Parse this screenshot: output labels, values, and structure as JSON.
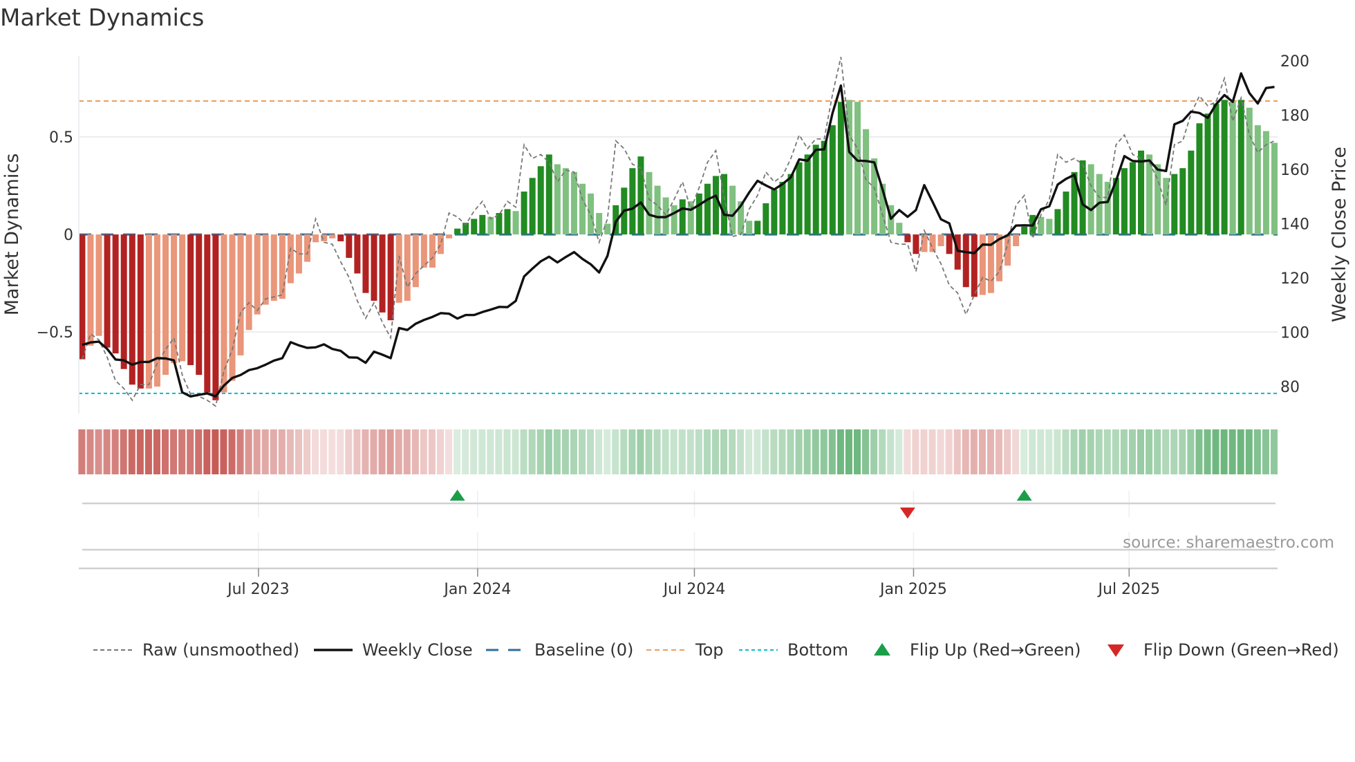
{
  "title": "Market Dynamics",
  "source": "source: sharemaestro.com",
  "colors": {
    "dark_red": "#b22222",
    "light_red": "#e9967a",
    "dark_green": "#228b22",
    "light_green": "#80c080",
    "raw": "#777777",
    "close": "#111111",
    "baseline": "#2c6f9e",
    "top": "#e8a46a",
    "bottom": "#17becf",
    "flip_up": "#1a9e4a",
    "flip_down": "#d62728",
    "strip_red": "#c65a55",
    "strip_green": "#4fa864"
  },
  "legend": [
    {
      "key": "raw",
      "label": "Raw (unsmoothed)"
    },
    {
      "key": "close",
      "label": "Weekly Close"
    },
    {
      "key": "baseline",
      "label": "Baseline (0)"
    },
    {
      "key": "top",
      "label": "Top"
    },
    {
      "key": "bottom",
      "label": "Bottom"
    },
    {
      "key": "flip_up",
      "label": "Flip Up (Red→Green)"
    },
    {
      "key": "flip_down",
      "label": "Flip Down (Green→Red)"
    }
  ],
  "chart_data": {
    "type": "bar",
    "title": "Market Dynamics",
    "ylabel": "Market Dynamics",
    "y2label": "Weekly Close Price",
    "ylim": [
      -0.918,
      0.915
    ],
    "y2lim": [
      70,
      201.8
    ],
    "yticks": [
      {
        "v": 0.5,
        "label": "0.5"
      },
      {
        "v": 0,
        "label": "0"
      },
      {
        "v": -0.5,
        "label": "−0.5"
      }
    ],
    "y2ticks": [
      200,
      180,
      160,
      140,
      120,
      100,
      80
    ],
    "xticks": [
      {
        "date": "2023-07-01",
        "label": "Jul 2023"
      },
      {
        "date": "2024-01-01",
        "label": "Jan 2024"
      },
      {
        "date": "2024-07-01",
        "label": "Jul 2024"
      },
      {
        "date": "2025-01-01",
        "label": "Jan 2025"
      },
      {
        "date": "2025-07-01",
        "label": "Jul 2025"
      }
    ],
    "start_date": "2023-02-03",
    "frequency": "weekly",
    "top_level": 0.684,
    "bottom_level": -0.815,
    "baseline": 0,
    "momentum": [
      -0.64,
      -0.57,
      -0.52,
      -0.58,
      -0.61,
      -0.69,
      -0.77,
      -0.79,
      -0.79,
      -0.78,
      -0.72,
      -0.66,
      -0.65,
      -0.67,
      -0.72,
      -0.81,
      -0.85,
      -0.81,
      -0.75,
      -0.62,
      -0.49,
      -0.41,
      -0.36,
      -0.34,
      -0.33,
      -0.25,
      -0.2,
      -0.14,
      -0.04,
      -0.035,
      -0.02,
      -0.035,
      -0.12,
      -0.2,
      -0.3,
      -0.34,
      -0.4,
      -0.44,
      -0.35,
      -0.34,
      -0.27,
      -0.17,
      -0.17,
      -0.1,
      -0.02,
      0.03,
      0.06,
      0.08,
      0.1,
      0.09,
      0.11,
      0.13,
      0.12,
      0.22,
      0.29,
      0.35,
      0.41,
      0.36,
      0.34,
      0.32,
      0.26,
      0.21,
      0.11,
      0.055,
      0.15,
      0.24,
      0.34,
      0.4,
      0.32,
      0.25,
      0.19,
      0.15,
      0.18,
      0.17,
      0.21,
      0.26,
      0.3,
      0.31,
      0.25,
      0.17,
      0.07,
      0.07,
      0.16,
      0.23,
      0.27,
      0.31,
      0.37,
      0.41,
      0.46,
      0.48,
      0.56,
      0.68,
      0.69,
      0.68,
      0.54,
      0.39,
      0.26,
      0.15,
      0.06,
      -0.04,
      -0.1,
      -0.09,
      -0.09,
      -0.06,
      -0.1,
      -0.18,
      -0.27,
      -0.32,
      -0.31,
      -0.3,
      -0.24,
      -0.16,
      -0.06,
      0.04,
      0.1,
      0.09,
      0.08,
      0.13,
      0.22,
      0.32,
      0.38,
      0.36,
      0.31,
      0.27,
      0.29,
      0.34,
      0.37,
      0.43,
      0.41,
      0.36,
      0.29,
      0.31,
      0.34,
      0.43,
      0.57,
      0.62,
      0.67,
      0.69,
      0.68,
      0.69,
      0.65,
      0.56,
      0.53,
      0.47
    ],
    "shade": "DLLDDDDDLLLLLDDDDLLLLLLLLLLLLLLDDDDDDDLLLLLLLDDDDLDDLDDDDLLLLLLLDDDDLLLLDLDDDDLLLDDDDDDDDDDDLLLLLLLDDLLLDDDDLLLLLDDLLDDDDLLLDDDDLLLDDDDDDDLDLLLL",
    "raw": [
      -0.64,
      -0.51,
      -0.54,
      -0.63,
      -0.75,
      -0.79,
      -0.85,
      -0.77,
      -0.77,
      -0.66,
      -0.59,
      -0.53,
      -0.72,
      -0.82,
      -0.83,
      -0.85,
      -0.88,
      -0.7,
      -0.59,
      -0.4,
      -0.35,
      -0.39,
      -0.33,
      -0.32,
      -0.31,
      -0.07,
      -0.1,
      -0.1,
      0.08,
      -0.04,
      -0.05,
      -0.14,
      -0.22,
      -0.34,
      -0.43,
      -0.35,
      -0.45,
      -0.53,
      -0.11,
      -0.27,
      -0.2,
      -0.16,
      -0.12,
      -0.05,
      0.11,
      0.09,
      0.05,
      0.12,
      0.17,
      0.08,
      0.1,
      0.17,
      0.14,
      0.46,
      0.39,
      0.41,
      0.37,
      0.27,
      0.33,
      0.32,
      0.18,
      0.1,
      -0.04,
      0.08,
      0.48,
      0.44,
      0.36,
      0.34,
      0.18,
      0.15,
      0.1,
      0.18,
      0.27,
      0.13,
      0.24,
      0.37,
      0.43,
      0.19,
      -0.01,
      0.0,
      0.13,
      0.2,
      0.32,
      0.27,
      0.3,
      0.39,
      0.51,
      0.44,
      0.49,
      0.49,
      0.72,
      0.91,
      0.51,
      0.44,
      0.28,
      0.24,
      0.1,
      -0.04,
      -0.05,
      -0.05,
      -0.19,
      0.02,
      -0.07,
      -0.15,
      -0.26,
      -0.3,
      -0.41,
      -0.31,
      -0.22,
      -0.24,
      -0.19,
      -0.05,
      0.15,
      0.2,
      -0.02,
      0.1,
      0.18,
      0.41,
      0.37,
      0.39,
      0.36,
      0.25,
      0.19,
      0.19,
      0.46,
      0.51,
      0.41,
      0.39,
      0.37,
      0.28,
      0.15,
      0.46,
      0.48,
      0.62,
      0.71,
      0.66,
      0.68,
      0.8,
      0.58,
      0.7,
      0.51,
      0.42,
      0.46,
      0.48
    ],
    "close": [
      95.3,
      96.2,
      96.5,
      93.8,
      89.9,
      89.6,
      88.0,
      89.0,
      89.0,
      90.4,
      90.3,
      89.6,
      77.8,
      76.3,
      76.9,
      77.4,
      76.3,
      80.3,
      83.1,
      84.2,
      86.0,
      86.7,
      88.0,
      89.5,
      90.4,
      96.3,
      95.1,
      94.2,
      94.4,
      95.5,
      93.8,
      93.1,
      90.7,
      90.6,
      88.7,
      92.8,
      91.7,
      90.4,
      101.5,
      100.8,
      103.1,
      104.5,
      105.6,
      107.0,
      106.8,
      105.0,
      106.3,
      106.3,
      107.4,
      108.3,
      109.3,
      109.2,
      111.5,
      120.5,
      123.4,
      126.1,
      127.8,
      125.7,
      127.7,
      129.5,
      127.0,
      125.0,
      122.0,
      128.1,
      140.7,
      144.8,
      145.5,
      147.8,
      143.3,
      142.4,
      142.4,
      143.9,
      145.6,
      145.1,
      146.9,
      148.9,
      150.3,
      143.3,
      142.9,
      146.6,
      151.5,
      155.8,
      154.1,
      152.6,
      154.6,
      157.1,
      163.7,
      163.2,
      167.2,
      167.4,
      180.8,
      190.9,
      166.4,
      163.2,
      163.1,
      162.6,
      152.6,
      141.8,
      145.0,
      142.5,
      145.0,
      154.2,
      148.0,
      141.6,
      140.1,
      130.0,
      129.5,
      129.1,
      132.3,
      132.2,
      134.3,
      135.7,
      139.3,
      139.4,
      139.3,
      145.3,
      146.4,
      154.4,
      156.5,
      158.0,
      147.1,
      145.0,
      147.7,
      148.0,
      155.8,
      164.9,
      163.1,
      162.9,
      163.3,
      159.9,
      159.4,
      176.6,
      177.9,
      181.3,
      180.8,
      179.0,
      184.0,
      187.4,
      184.9,
      195.4,
      188.1,
      184.3,
      190.0,
      190.4
    ],
    "flips": [
      {
        "week_index": 45,
        "type": "up"
      },
      {
        "week_index": 99,
        "type": "down"
      },
      {
        "week_index": 113,
        "type": "up"
      }
    ]
  }
}
